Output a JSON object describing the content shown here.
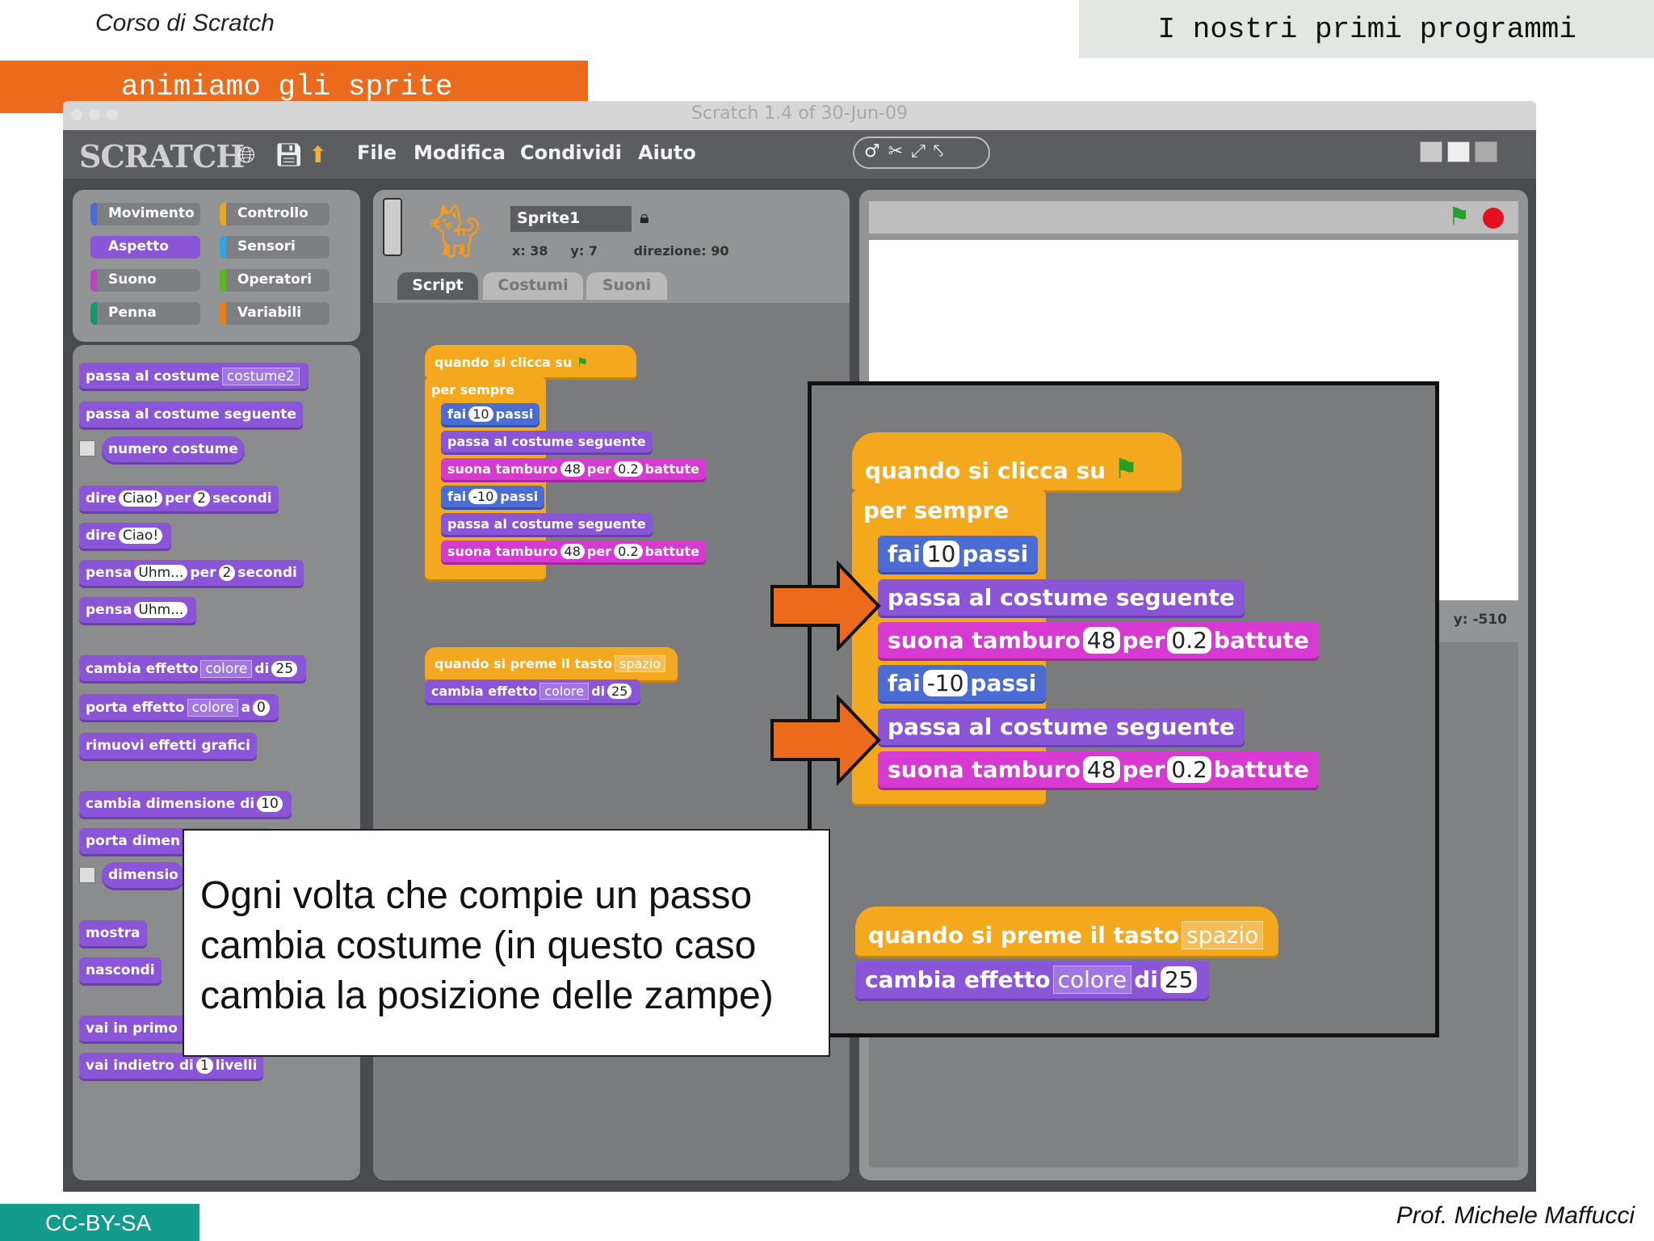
{
  "slide": {
    "course": "Corso di Scratch",
    "title": "I nostri primi programmi",
    "subtitle": "animiamo gli sprite",
    "license": "CC-BY-SA",
    "author": "Prof. Michele Maffucci",
    "note": "Ogni volta che compie un passo cambia costume (in questo caso cambia la posizione delle zampe)"
  },
  "window": {
    "title": "Scratch 1.4 of 30-Jun-09",
    "logo": "SCRATCH",
    "menu": [
      "File",
      "Modifica",
      "Condividi",
      "Aiuto"
    ],
    "icons": [
      "globe-icon",
      "save-icon",
      "share-icon"
    ],
    "tool_icons": [
      "stamp-icon",
      "scissors-icon",
      "grow-icon",
      "shrink-icon"
    ]
  },
  "categories": [
    {
      "label": "Movimento",
      "color": "#4a6cd4"
    },
    {
      "label": "Controllo",
      "color": "#e6a822"
    },
    {
      "label": "Aspetto",
      "color": "#8a55d7"
    },
    {
      "label": "Sensori",
      "color": "#2ca5e2"
    },
    {
      "label": "Suono",
      "color": "#bb42c3"
    },
    {
      "label": "Operatori",
      "color": "#5cb712"
    },
    {
      "label": "Penna",
      "color": "#0e9a6c"
    },
    {
      "label": "Variabili",
      "color": "#ee7d16"
    }
  ],
  "palette": {
    "switch_costume": "passa al costume",
    "costume2": "costume2",
    "next_costume": "passa al costume seguente",
    "costume_number": "numero costume",
    "say": "dire",
    "hello": "Ciao!",
    "for": "per",
    "secs": "secondi",
    "two": "2",
    "think": "pensa",
    "hmm": "Uhm...",
    "change_effect": "cambia effetto",
    "color": "colore",
    "by": "di",
    "set_effect": "porta effetto",
    "to": "a",
    "zero": "0",
    "twentyfive": "25",
    "clear_effects": "rimuovi effetti grafici",
    "change_size": "cambia dimensione di",
    "ten": "10",
    "set_size": "porta dimen",
    "size": "dimensio",
    "show": "mostra",
    "hide": "nascondi",
    "front": "vai in primo",
    "back": "vai indietro di",
    "layers_tail": "livelli",
    "one": "1"
  },
  "sprite": {
    "name": "Sprite1",
    "x_label": "x:",
    "x": "38",
    "y_label": "y:",
    "y": "7",
    "dir_label": "direzione:",
    "direction": "90",
    "tabs": [
      "Script",
      "Costumi",
      "Suoni"
    ]
  },
  "stage": {
    "y_label": "y:",
    "mouse_y": "-510"
  },
  "script": {
    "when_flag": "quando si clicca su",
    "forever": "per sempre",
    "move": "fai",
    "steps": "passi",
    "ten": "10",
    "minus_ten": "-10",
    "next_costume": "passa al costume seguente",
    "play_drum": "suona tamburo",
    "drum": "48",
    "for": "per",
    "beats_value": "0.2",
    "beats": "battute",
    "when_key": "quando si preme il tasto",
    "key": "spazio",
    "change_effect": "cambia effetto",
    "effect": "colore",
    "by": "di",
    "amount": "25"
  }
}
